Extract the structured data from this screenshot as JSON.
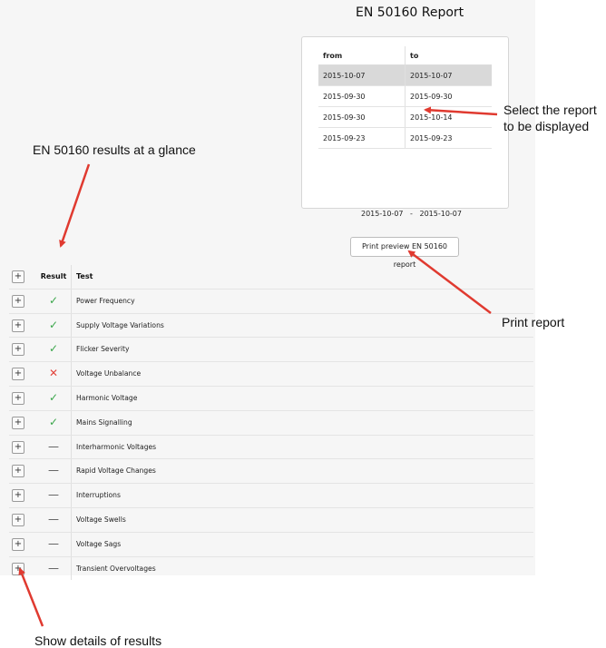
{
  "title": "EN 50160 Report",
  "report_table": {
    "headers": {
      "from": "from",
      "to": "to"
    },
    "rows": [
      {
        "from": "2015-10-07",
        "to": "2015-10-07",
        "selected": true
      },
      {
        "from": "2015-09-30",
        "to": "2015-09-30",
        "selected": false
      },
      {
        "from": "2015-09-30",
        "to": "2015-10-14",
        "selected": false
      },
      {
        "from": "2015-09-23",
        "to": "2015-09-23",
        "selected": false
      }
    ]
  },
  "selected_range": {
    "from": "2015-10-07",
    "sep": "-",
    "to": "2015-10-07"
  },
  "print_button": "Print preview EN 50160 report",
  "results": {
    "header": {
      "result": "Result",
      "test": "Test"
    },
    "rows": [
      {
        "status": "pass",
        "symbol": "✓",
        "test": "Power Frequency"
      },
      {
        "status": "pass",
        "symbol": "✓",
        "test": "Supply Voltage Variations"
      },
      {
        "status": "pass",
        "symbol": "✓",
        "test": "Flicker Severity"
      },
      {
        "status": "fail",
        "symbol": "✕",
        "test": "Voltage Unbalance"
      },
      {
        "status": "pass",
        "symbol": "✓",
        "test": "Harmonic Voltage"
      },
      {
        "status": "pass",
        "symbol": "✓",
        "test": "Mains Signalling"
      },
      {
        "status": "na",
        "symbol": "—",
        "test": "Interharmonic Voltages"
      },
      {
        "status": "na",
        "symbol": "—",
        "test": "Rapid Voltage Changes"
      },
      {
        "status": "na",
        "symbol": "—",
        "test": "Interruptions"
      },
      {
        "status": "na",
        "symbol": "—",
        "test": "Voltage Swells"
      },
      {
        "status": "na",
        "symbol": "—",
        "test": "Voltage Sags"
      },
      {
        "status": "na",
        "symbol": "—",
        "test": "Transient Overvoltages"
      }
    ]
  },
  "annotations": {
    "select_report_line1": "Select the report",
    "select_report_line2": "to be displayed",
    "at_a_glance": "EN 50160 results at a glance",
    "print_report": "Print report",
    "show_details": "Show details of results"
  },
  "colors": {
    "pass": "#3aa64a",
    "fail": "#e2453d",
    "arrow": "#e03a30",
    "selected_row": "#d9d9d9"
  },
  "icons": {
    "expand": "plus-icon",
    "pass": "check-icon",
    "fail": "cross-icon",
    "na": "dash-icon"
  }
}
